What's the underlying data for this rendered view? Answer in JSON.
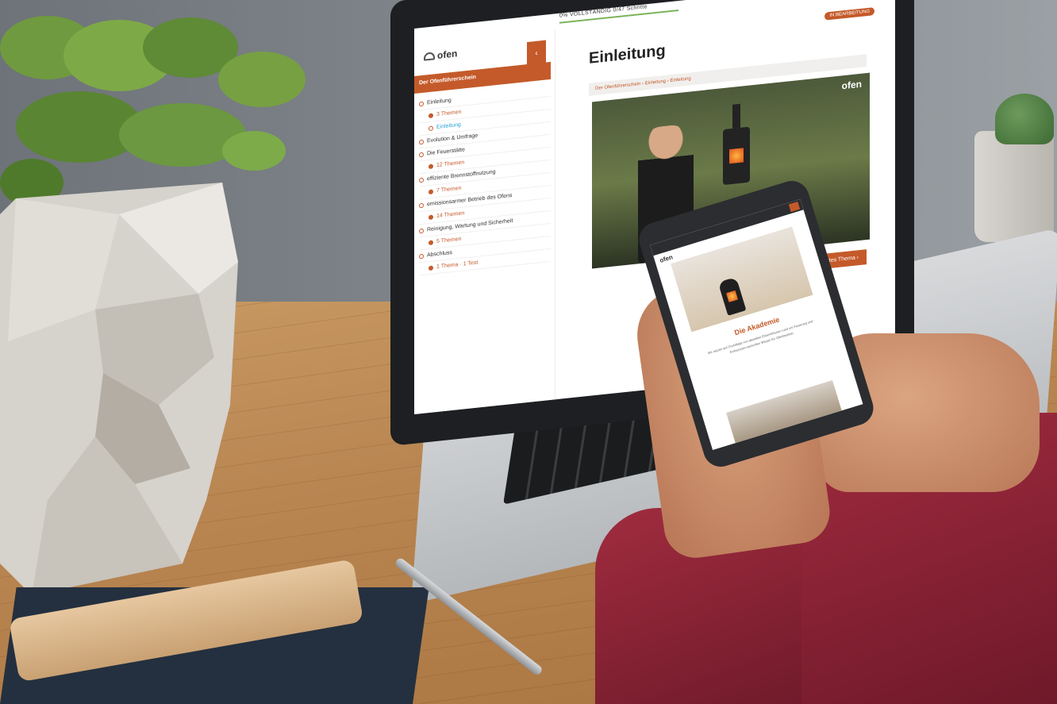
{
  "laptop": {
    "progress_text": "0% VOLLSTÄNDIG 0/47 Schritte",
    "logo_text": "ofen",
    "sidebar_collapse_glyph": "‹",
    "sidebar_title": "Der Ofenführerschein",
    "toc": [
      {
        "label": "Einleitung",
        "type": "chapter"
      },
      {
        "label": "3 Themen",
        "type": "sub"
      },
      {
        "label": "Einleitung",
        "type": "active"
      },
      {
        "label": "Evolution & Umfrage",
        "type": "chapter"
      },
      {
        "label": "Die Feuerstätte",
        "type": "chapter"
      },
      {
        "label": "12 Themen",
        "type": "sub"
      },
      {
        "label": "effiziente Brennstoffnutzung",
        "type": "chapter"
      },
      {
        "label": "7 Themen",
        "type": "sub"
      },
      {
        "label": "emissionsarmer Betrieb des Ofens",
        "type": "chapter"
      },
      {
        "label": "14 Themen",
        "type": "sub"
      },
      {
        "label": "Reinigung, Wartung und Sicherheit",
        "type": "chapter"
      },
      {
        "label": "5 Themen",
        "type": "sub"
      },
      {
        "label": "Abschluss",
        "type": "chapter"
      },
      {
        "label": "1 Thema · 1 Test",
        "type": "sub"
      }
    ],
    "badge": "IN BEARBEITUNG",
    "page_title": "Einleitung",
    "breadcrumb": "Der Ofenführerschein › Einleitung › Einleitung",
    "video_logo": "ofen",
    "next_button": "Nächstes Thema ›"
  },
  "phone": {
    "logo_text": "ofen",
    "title": "Die Akademie",
    "body": "Wir setzen auf Grundlage von aktuellen Erkenntnissen rund um Feuerung und Emissionen wertvolles Wissen für Ofenbesitzer."
  },
  "colors": {
    "accent": "#c45a2a",
    "link": "#2aa0d6",
    "progress": "#7bb35a"
  }
}
